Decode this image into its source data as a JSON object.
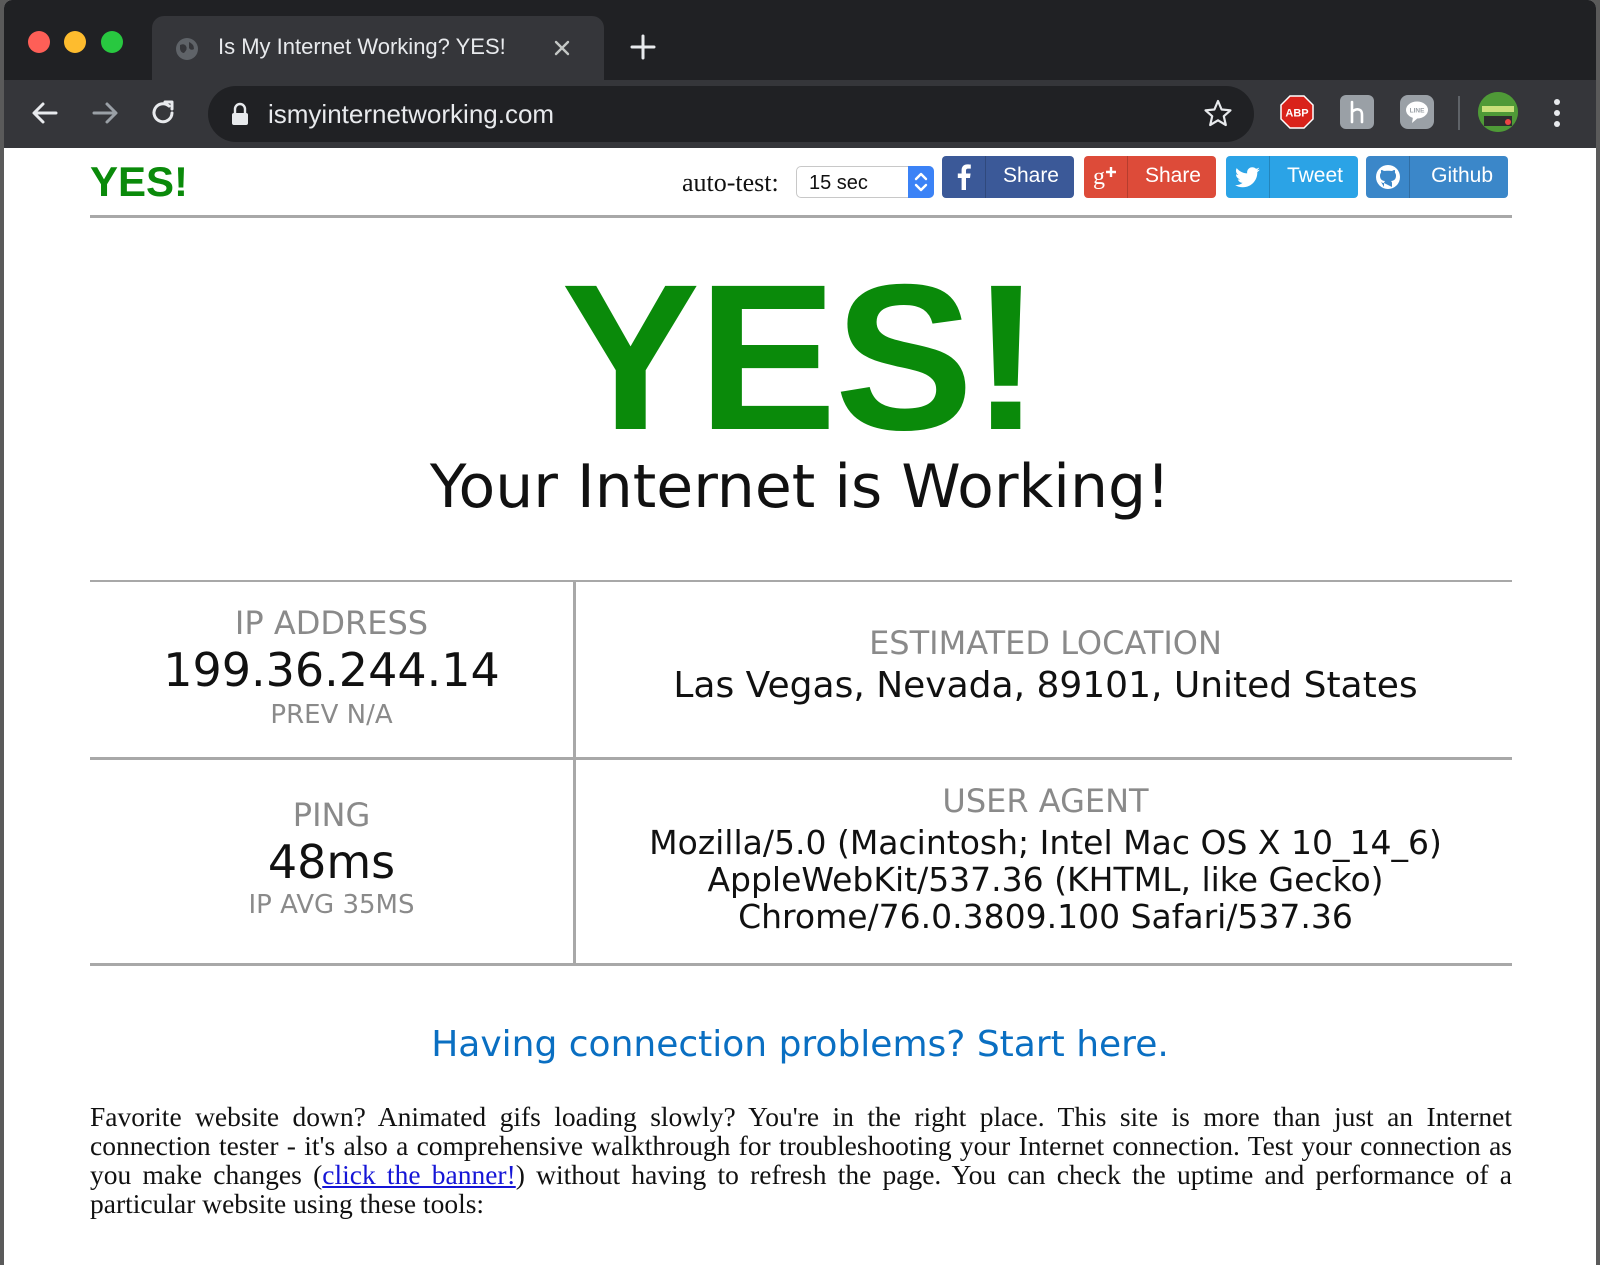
{
  "browser": {
    "tab_title": "Is My Internet Working? YES!",
    "url": "ismyinternetworking.com",
    "extensions": [
      "abp-icon",
      "h-icon",
      "line-icon"
    ],
    "abp_label": "ABP",
    "line_label": "LINE"
  },
  "header": {
    "brand": "YES!",
    "autotest_label": "auto-test:",
    "autotest_value": "15 sec",
    "social": {
      "facebook": "Share",
      "googleplus": "Share",
      "twitter": "Tweet",
      "github": "Github"
    }
  },
  "hero": {
    "status": "YES!",
    "message": "Your Internet is Working!"
  },
  "info": {
    "ip": {
      "label": "IP ADDRESS",
      "value": "199.36.244.14",
      "sub": "PREV N/A"
    },
    "location": {
      "label": "ESTIMATED LOCATION",
      "value": "Las Vegas, Nevada, 89101, United States"
    },
    "ping": {
      "label": "PING",
      "value": "48ms",
      "sub": "IP AVG 35MS"
    },
    "user_agent": {
      "label": "USER AGENT",
      "line1": "Mozilla/5.0 (Macintosh; Intel Mac OS X 10_14_6)",
      "line2": "AppleWebKit/537.36 (KHTML, like Gecko)",
      "line3": "Chrome/76.0.3809.100 Safari/537.36"
    }
  },
  "help_link": "Having connection problems? Start here.",
  "paragraph": {
    "before_link": "Favorite website down? Animated gifs loading slowly? You're in the right place. This site is more than just an Internet connection tester - it's also a comprehensive walkthrough for troubleshooting your Internet connection. Test your connection as you make changes (",
    "link": "click the banner!",
    "after_link": ") without having to refresh the page. You can check the uptime and performance of a particular website using these tools:"
  },
  "colors": {
    "brand_green": "#0a8a0a",
    "link_blue": "#0a6fc2",
    "facebook": "#3b5998",
    "googleplus": "#dd4b39",
    "twitter": "#2ba3e6",
    "github": "#3b87c9"
  }
}
